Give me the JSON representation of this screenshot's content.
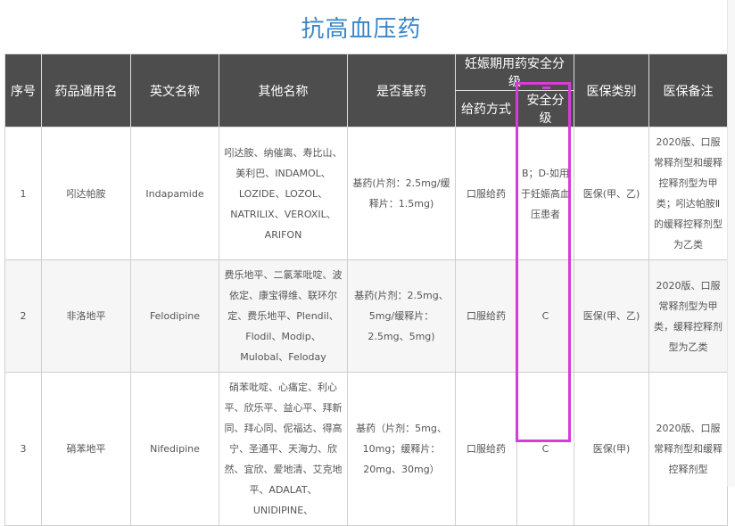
{
  "title": "抗高血压药",
  "headers": {
    "index": "序号",
    "generic_name": "药品通用名",
    "english_name": "英文名称",
    "other_names": "其他名称",
    "essential": "是否基药",
    "pregnancy_group": "妊娠期用药安全分级",
    "route": "给药方式",
    "safety_grade": "安全分级",
    "insurance_type": "医保类别",
    "insurance_notes": "医保备注"
  },
  "rows": [
    {
      "index": "1",
      "generic_name": "吲达帕胺",
      "english_name": "Indapamide",
      "other_names": "吲达胺、纳催离、寿比山、美利巴、INDAMOL、LOZIDE、LOZOL、NATRILIX、VEROXIL、ARIFON",
      "essential": "基药(片剂：2.5mg/缓释片：1.5mg)",
      "route": "口服给药",
      "safety_grade": "B；D-如用于妊娠高血压患者",
      "insurance_type": "医保(甲、乙)",
      "insurance_notes": "2020版、口服常释剂型和缓释控释剂型为甲类；吲达帕胺Ⅱ的缓释控释剂型为乙类"
    },
    {
      "index": "2",
      "generic_name": "非洛地平",
      "english_name": "Felodipine",
      "other_names": "费乐地平、二氯苯吡啶、波依定、康宝得维、联环尔定、费乐地平、Plendil、Flodil、Modip、Mulobal、Feloday",
      "essential": "基药(片剂：2.5mg、5mg/缓释片：2.5mg、5mg)",
      "route": "口服给药",
      "safety_grade": "C",
      "insurance_type": "医保(甲、乙)",
      "insurance_notes": "2020版、口服常释剂型为甲类，缓释控释剂型为乙类"
    },
    {
      "index": "3",
      "generic_name": "硝苯地平",
      "english_name": "Nifedipine",
      "other_names": "硝苯吡啶、心痛定、利心平、欣乐平、益心平、拜新同、拜心同、伲福达、得高宁、圣通平、天海力、欣然、宜欣、爱地清、艾克地平、ADALAT、UNIDIPINE、",
      "essential": "基药（片剂：5mg、10mg；缓释片：20mg、30mg）",
      "route": "口服给药",
      "safety_grade": "C",
      "insurance_type": "医保(甲)",
      "insurance_notes": "2020版、口服常释剂型和缓释控释剂型"
    }
  ]
}
